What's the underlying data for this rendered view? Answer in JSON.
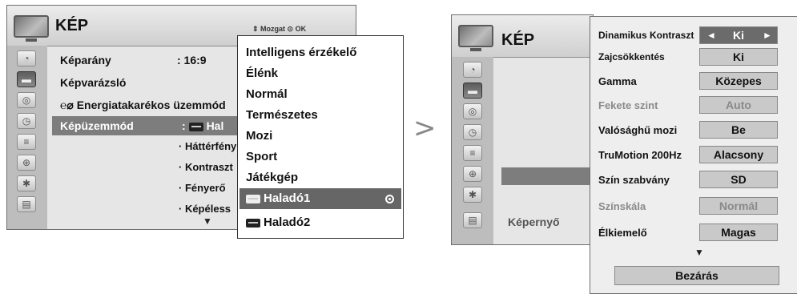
{
  "left_panel": {
    "title": "KÉP",
    "hint": "⇕ Mozgat  ⊙ OK",
    "rows": [
      {
        "label": "Képarány",
        "value": ": 16:9"
      },
      {
        "label": "Képvarázsló",
        "value": ""
      },
      {
        "label": "℮⌀ Energiatakarékos üzemmód",
        "value": ""
      },
      {
        "label": "Képüzemmód",
        "value": ": ",
        "value_suffix": "Hal"
      }
    ],
    "subitems": [
      "· Háttérfény",
      "· Kontraszt",
      "· Fényerő",
      "· Képéless"
    ],
    "scroll_down": "▼"
  },
  "dropdown": {
    "items": [
      "Intelligens érzékelő",
      "Élénk",
      "Normál",
      "Természetes",
      "Mozi",
      "Sport",
      "Játékgép",
      "Haladó1",
      "Haladó2"
    ],
    "selected_index": 7
  },
  "arrow_glyph": ">",
  "right_panel": {
    "title": "KÉP",
    "bottom_label": "Képernyő",
    "settings": [
      {
        "label": "Dinamikus Kontraszt",
        "value": "Ki",
        "state": "active"
      },
      {
        "label": "Zajcsökkentés",
        "value": "Ki",
        "state": "normal"
      },
      {
        "label": "Gamma",
        "value": "Közepes",
        "state": "normal"
      },
      {
        "label": "Fekete szint",
        "value": "Auto",
        "state": "dim"
      },
      {
        "label": "Valósághű mozi",
        "value": "Be",
        "state": "normal"
      },
      {
        "label": "TruMotion 200Hz",
        "value": "Alacsony",
        "state": "normal"
      },
      {
        "label": "Szín szabvány",
        "value": "SD",
        "state": "normal"
      },
      {
        "label": "Színskála",
        "value": "Normál",
        "state": "dim"
      },
      {
        "label": "Élkiemelő",
        "value": "Magas",
        "state": "normal"
      }
    ],
    "value_left_arrow": "◄",
    "value_right_arrow": "►",
    "scroll_down": "▼",
    "close_button": "Bezárás"
  },
  "colors": {
    "highlight": "#7d7d7d",
    "sidebar": "#bdbdbd",
    "selected_dropdown": "#666666"
  }
}
